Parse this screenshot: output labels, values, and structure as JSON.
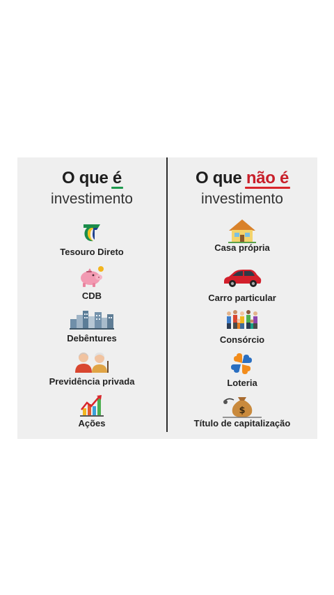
{
  "left": {
    "heading_prefix": "O que",
    "heading_highlight": "é",
    "subheading": "investimento",
    "items": [
      {
        "label": "Tesouro Direto",
        "icon": "tesouro-logo-icon"
      },
      {
        "label": "CDB",
        "icon": "piggy-bank-icon"
      },
      {
        "label": "Debêntures",
        "icon": "city-buildings-icon"
      },
      {
        "label": "Previdência privada",
        "icon": "elderly-couple-icon"
      },
      {
        "label": "Ações",
        "icon": "stock-chart-icon"
      }
    ]
  },
  "right": {
    "heading_prefix": "O que",
    "heading_highlight": "não é",
    "subheading": "investimento",
    "items": [
      {
        "label": "Casa própria",
        "icon": "house-icon"
      },
      {
        "label": "Carro particular",
        "icon": "car-icon"
      },
      {
        "label": "Consórcio",
        "icon": "people-group-icon"
      },
      {
        "label": "Loteria",
        "icon": "lottery-clover-icon"
      },
      {
        "label": "Título de capitalização",
        "icon": "money-bag-icon"
      }
    ]
  },
  "colors": {
    "card_background": "#efefef",
    "left_accent": "#1e9a4e",
    "right_accent": "#d9252b",
    "text": "#222222"
  }
}
